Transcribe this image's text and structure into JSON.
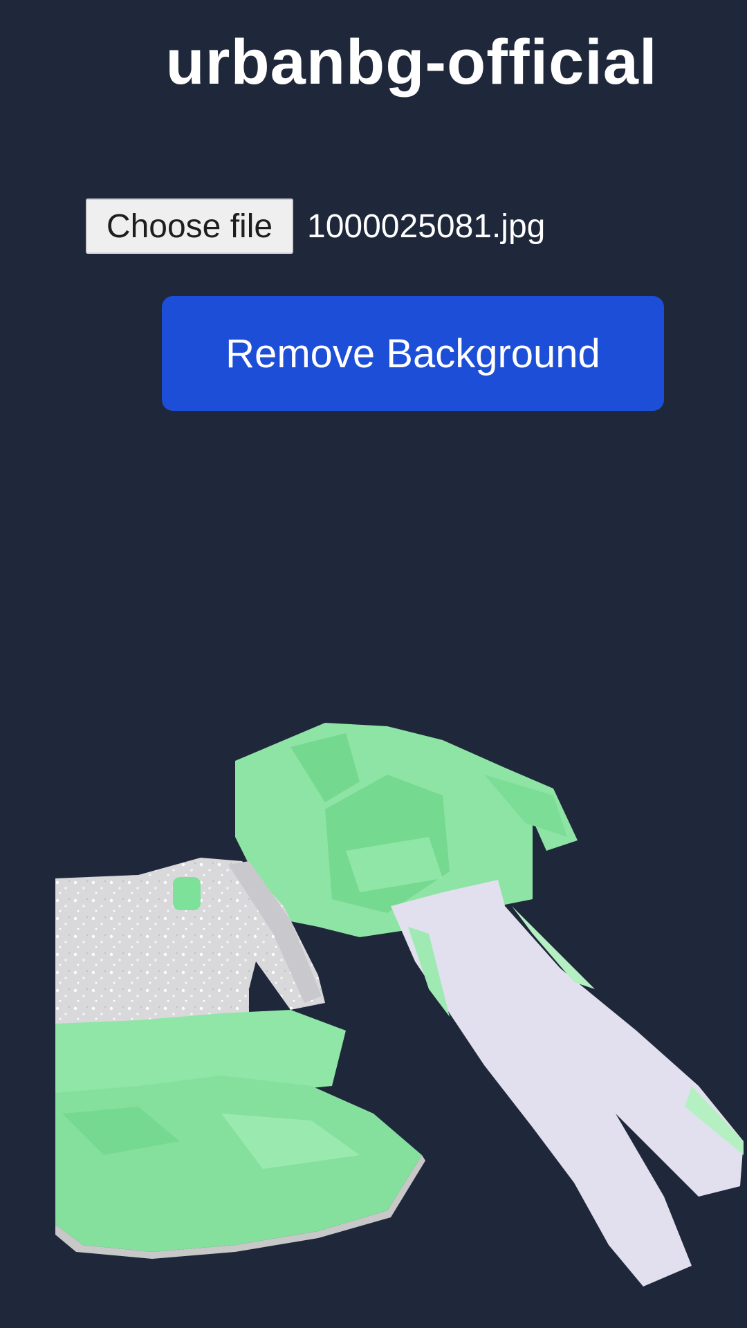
{
  "header": {
    "title": "urbanbg-official"
  },
  "file_input": {
    "button_label": "Choose file",
    "file_name": "1000025081.jpg"
  },
  "actions": {
    "remove_background_label": "Remove Background"
  },
  "colors": {
    "background": "#1f283b",
    "primary_button": "#1d4ed8",
    "clothing_green": "#7fe39c",
    "clothing_white": "#e3e1ee"
  }
}
